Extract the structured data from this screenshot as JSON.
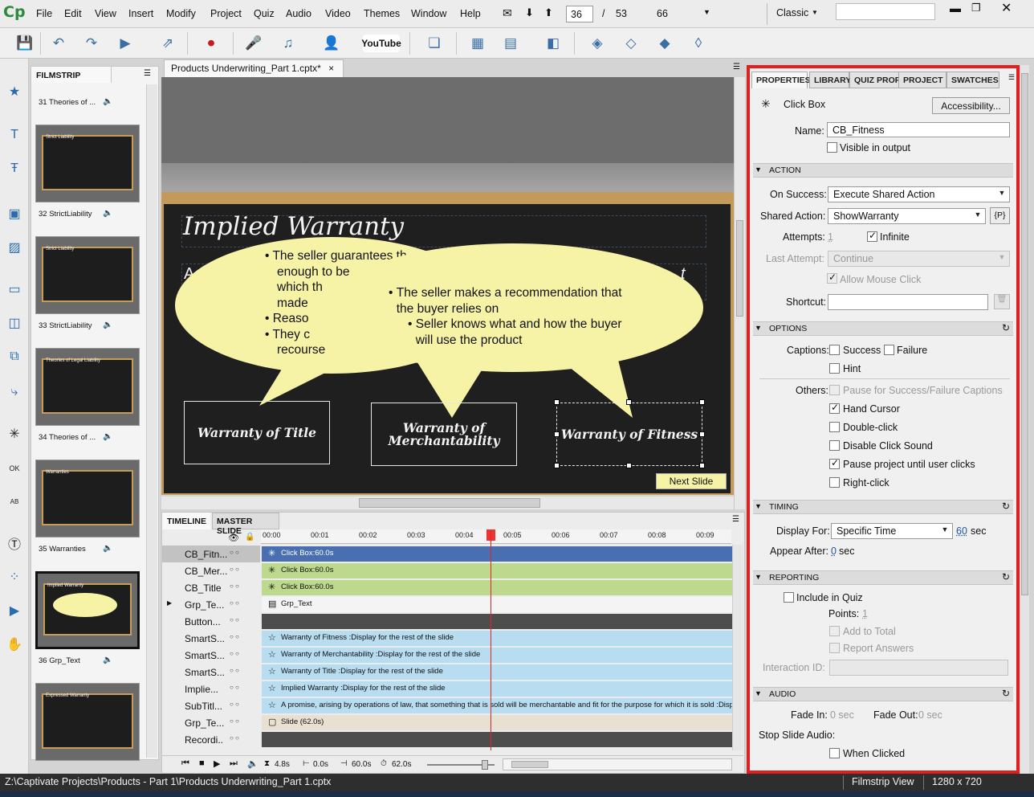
{
  "app": {
    "logo": "Cp"
  },
  "menu": [
    "File",
    "Edit",
    "View",
    "Insert",
    "Modify",
    "Project",
    "Quiz",
    "Audio",
    "Video",
    "Themes",
    "Window",
    "Help"
  ],
  "nav": {
    "current_slide": "36",
    "separator": "/",
    "total_slides": "53",
    "zoom": "66",
    "workspace": "Classic"
  },
  "toolbar_icons": [
    "save-icon",
    "undo-icon",
    "redo-icon",
    "preview-icon",
    "publish-icon",
    "record-icon",
    "microphone-icon",
    "audio-icon",
    "character-icon",
    "youtube-icon",
    "library-icon",
    "table-icon",
    "grid-icon",
    "interaction-icon",
    "bring-forward-icon",
    "send-backward-icon",
    "bring-front-icon",
    "send-back-icon"
  ],
  "youtube_label": "YouTube",
  "filmstrip": {
    "title": "FILMSTRIP",
    "slides": [
      {
        "label": "31 Theories of ...",
        "caption": ""
      },
      {
        "label": "32 StrictLiability",
        "caption": "Strict Liability"
      },
      {
        "label": "33 StrictLiability",
        "caption": "Strict Liability"
      },
      {
        "label": "34 Theories of ...",
        "caption": "Theories of Legal Liability"
      },
      {
        "label": "35 Warranties",
        "caption": "Warranties"
      },
      {
        "label": "36 Grp_Text",
        "caption": "Implied Warranty"
      },
      {
        "label": "",
        "caption": "Expressed Warranty"
      }
    ]
  },
  "document": {
    "tab_title": "Products Underwriting_Part 1.cptx*",
    "close": "×"
  },
  "slide": {
    "title": "Implied Warranty",
    "bubble1_items": [
      "The seller guarantees th",
      "enough to be",
      "which th",
      "made",
      "Reaso",
      "They c",
      "recourse"
    ],
    "bubble2_item": "The seller makes a recommendation that the buyer relies on",
    "bubble2_sub": "Seller knows what and how the buyer will use the product",
    "warranty_title": "Warranty of Title",
    "warranty_merch_1": "Warranty of",
    "warranty_merch_2": "Merchantability",
    "warranty_fitness": "Warranty of Fitness",
    "next_slide": "Next Slide",
    "stray_a": "A",
    "stray_t": "t"
  },
  "timeline": {
    "tabs": [
      "TIMELINE",
      "MASTER SLIDE"
    ],
    "ticks": [
      "00:00",
      "00:01",
      "00:02",
      "00:03",
      "00:04",
      "00:05",
      "00:06",
      "00:07",
      "00:08",
      "00:09"
    ],
    "rows": [
      {
        "name": "CB_Fitn...",
        "bar": "Click Box:60.0s",
        "color": "#4a6fb0",
        "text": "#ffffff",
        "selected": true
      },
      {
        "name": "CB_Mer...",
        "bar": "Click Box:60.0s",
        "color": "#bcd98e",
        "text": "#111111"
      },
      {
        "name": "CB_Title",
        "bar": "Click Box:60.0s",
        "color": "#bcd98e",
        "text": "#111111"
      },
      {
        "name": "Grp_Te...",
        "bar": "Grp_Text",
        "color": "#f4f4f4",
        "text": "#111111"
      },
      {
        "name": "Button...",
        "bar": "",
        "color": "#4d4d4d",
        "text": "#ffffff"
      },
      {
        "name": "SmartS...",
        "bar": "Warranty of Fitness :Display for the rest of the slide",
        "color": "#b8dcf0",
        "text": "#111111"
      },
      {
        "name": "SmartS...",
        "bar": "Warranty of Merchantability :Display for the rest of the slide",
        "color": "#b8dcf0",
        "text": "#111111"
      },
      {
        "name": "SmartS...",
        "bar": "Warranty of Title :Display for the rest of the slide",
        "color": "#b8dcf0",
        "text": "#111111"
      },
      {
        "name": "Implie...",
        "bar": "Implied Warranty :Display for the rest of the slide",
        "color": "#b8dcf0",
        "text": "#111111"
      },
      {
        "name": "SubTitl...",
        "bar": "A promise, arising by operations of law, that something that is sold will be merchantable and fit for the purpose for which it is sold :Display",
        "color": "#b8dcf0",
        "text": "#111111"
      },
      {
        "name": "Grp_Te...",
        "bar": "Slide (62.0s)",
        "color": "#e8e0d0",
        "text": "#111111"
      },
      {
        "name": "Recordi..",
        "bar": "",
        "color": "#4d4d4d",
        "text": "#ffffff"
      }
    ],
    "footer": {
      "t1": "4.8s",
      "t2": "0.0s",
      "t3": "60.0s",
      "t4": "62.0s"
    }
  },
  "properties": {
    "tabs": [
      "PROPERTIES",
      "LIBRARY",
      "QUIZ PROP",
      "PROJECT IN",
      "SWATCHES"
    ],
    "object_type": "Click Box",
    "accessibility": "Accessibility...",
    "name_label": "Name:",
    "name_value": "CB_Fitness",
    "visible_in_output": "Visible in output",
    "section_action": "ACTION",
    "on_success_label": "On Success:",
    "on_success_value": "Execute Shared Action",
    "shared_action_label": "Shared Action:",
    "shared_action_value": "ShowWarranty",
    "param_button": "{P}",
    "attempts_label": "Attempts:",
    "attempts_value": "1",
    "infinite": "Infinite",
    "last_attempt_label": "Last Attempt:",
    "last_attempt_value": "Continue",
    "allow_mouse_click": "Allow Mouse Click",
    "shortcut_label": "Shortcut:",
    "section_options": "OPTIONS",
    "captions_label": "Captions:",
    "success": "Success",
    "failure": "Failure",
    "hint": "Hint",
    "others_label": "Others:",
    "pause_captions": "Pause for Success/Failure Captions",
    "hand_cursor": "Hand Cursor",
    "double_click": "Double-click",
    "disable_click_sound": "Disable Click Sound",
    "pause_project": "Pause project until user clicks",
    "right_click": "Right-click",
    "section_timing": "TIMING",
    "display_for_label": "Display For:",
    "display_for_value": "Specific Time",
    "display_seconds": "60",
    "sec": "sec",
    "appear_after_label": "Appear After:",
    "appear_after_value": "0",
    "section_reporting": "REPORTING",
    "include_in_quiz": "Include in Quiz",
    "points_label": "Points:",
    "points_value": "1",
    "add_to_total": "Add to Total",
    "report_answers": "Report Answers",
    "interaction_id_label": "Interaction ID:",
    "section_audio": "AUDIO",
    "fade_in_label": "Fade In:",
    "fade_in_value": "0 sec",
    "fade_out_label": "Fade Out:",
    "fade_out_value": "0 sec",
    "stop_slide_audio": "Stop Slide Audio:",
    "when_clicked": "When Clicked"
  },
  "status": {
    "path": "Z:\\Captivate Projects\\Products - Part 1\\Products Underwriting_Part 1.cptx",
    "view": "Filmstrip View",
    "resolution": "1280 x 720"
  }
}
